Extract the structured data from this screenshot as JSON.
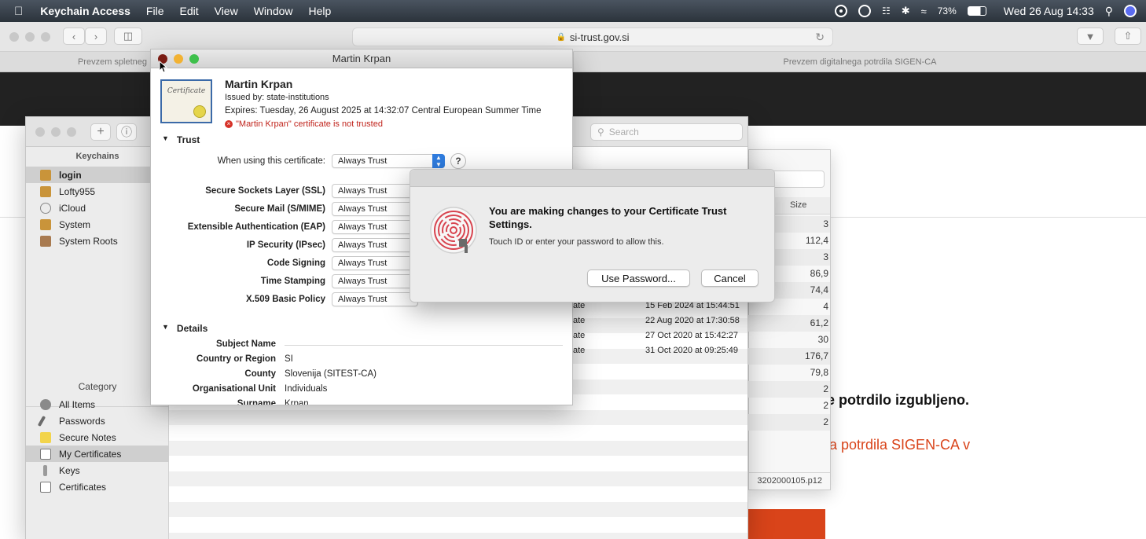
{
  "menubar": {
    "app_name": "Keychain Access",
    "menus": [
      "File",
      "Edit",
      "View",
      "Window",
      "Help"
    ],
    "battery": "73%",
    "datetime": "Wed 26 Aug  14:33"
  },
  "browser": {
    "url": "si-trust.gov.si",
    "tabs": [
      "Prevzem spletneg",
      "Prevzem digitalnega potrdila SIGEN-CA"
    ],
    "page_text": {
      "heading_fragment": "e potrdilo izgubljeno.",
      "link_fragment": "a potrdila SIGEN-CA v"
    },
    "accent_color": "#d9441a"
  },
  "keychain": {
    "search_placeholder": "Search",
    "keychains_header": "Keychains",
    "keychains": [
      "login",
      "Lofty955",
      "iCloud",
      "System",
      "System Roots"
    ],
    "category_header": "Category",
    "categories": [
      "All Items",
      "Passwords",
      "Secure Notes",
      "My Certificates",
      "Keys",
      "Certificates"
    ],
    "list_rows": [
      {
        "kind": "ate",
        "date": "15 Feb 2024 at 15:44:51"
      },
      {
        "kind": "ate",
        "date": "22 Aug 2020 at 17:30:58"
      },
      {
        "kind": "ate",
        "date": "27 Oct 2020 at 15:42:27"
      },
      {
        "kind": "ate",
        "date": "31 Oct 2020 at 09:25:49"
      }
    ]
  },
  "panel2": {
    "size_header": "Size",
    "sizes": [
      "3",
      "112,4",
      "3",
      "86,9",
      "74,4",
      "4",
      "61,2",
      "30",
      "176,7",
      "79,8",
      "2",
      "2",
      "2"
    ],
    "filename": "3202000105.p12"
  },
  "cert": {
    "window_title": "Martin Krpan",
    "name": "Martin Krpan",
    "issued_by": "Issued by: state-institutions",
    "expires": "Expires: Tuesday, 26 August 2025 at 14:32:07 Central European Summer Time",
    "warning": "\"Martin Krpan\" certificate is not trusted",
    "trust_section": "Trust",
    "when_using_label": "When using this certificate:",
    "when_using_value": "Always Trust",
    "help": "?",
    "trust_rows": [
      {
        "label": "Secure Sockets Layer (SSL)",
        "value": "Always Trust"
      },
      {
        "label": "Secure Mail (S/MIME)",
        "value": "Always Trust"
      },
      {
        "label": "Extensible Authentication (EAP)",
        "value": "Always Trust"
      },
      {
        "label": "IP Security (IPsec)",
        "value": "Always Trust"
      },
      {
        "label": "Code Signing",
        "value": "Always Trust"
      },
      {
        "label": "Time Stamping",
        "value": "Always Trust"
      },
      {
        "label": "X.509 Basic Policy",
        "value": "Always Trust"
      }
    ],
    "details_section": "Details",
    "details": [
      {
        "label": "Subject Name",
        "value": ""
      },
      {
        "label": "Country or Region",
        "value": "SI"
      },
      {
        "label": "County",
        "value": "Slovenija (SITEST-CA)"
      },
      {
        "label": "Organisational Unit",
        "value": "Individuals"
      },
      {
        "label": "Surname",
        "value": "Krpan"
      }
    ],
    "thumbnail_text": "Certificate"
  },
  "auth": {
    "title": "You are making changes to your Certificate Trust Settings.",
    "message": "Touch ID or enter your password to allow this.",
    "use_password": "Use Password...",
    "cancel": "Cancel"
  }
}
